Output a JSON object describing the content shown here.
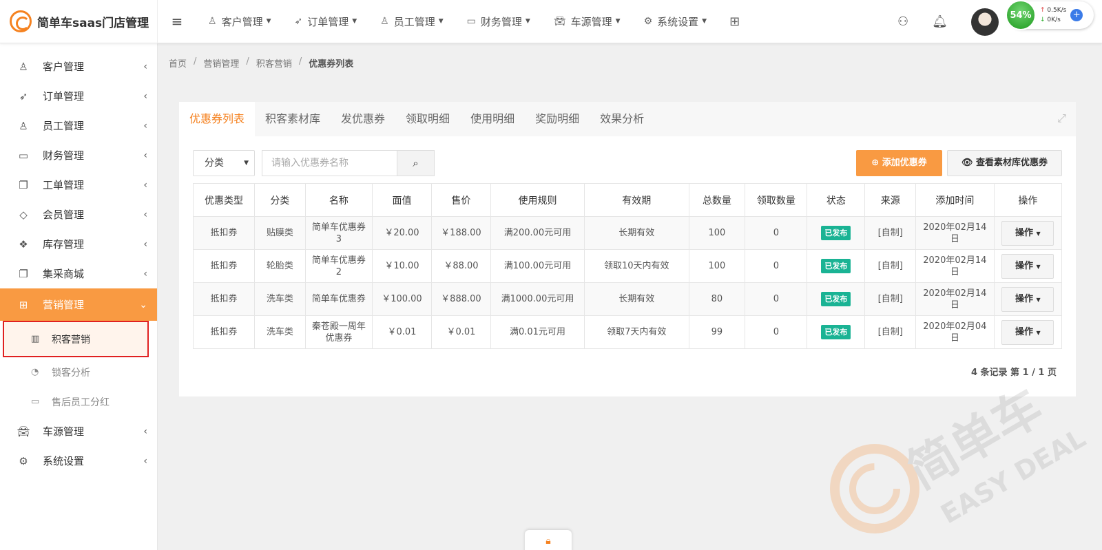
{
  "brand": {
    "title": "简单车saas门店管理"
  },
  "topnav": {
    "items": [
      {
        "label": "客户管理",
        "icon": "person-icon"
      },
      {
        "label": "订单管理",
        "icon": "rocket-icon"
      },
      {
        "label": "员工管理",
        "icon": "person-icon"
      },
      {
        "label": "财务管理",
        "icon": "folder-icon"
      },
      {
        "label": "车源管理",
        "icon": "car-icon"
      },
      {
        "label": "系统设置",
        "icon": "gear-icon"
      }
    ],
    "net": {
      "percent": "54%",
      "up": "0.5K/s",
      "down": "0K/s"
    }
  },
  "sidebar": {
    "items": [
      {
        "label": "客户管理"
      },
      {
        "label": "订单管理"
      },
      {
        "label": "员工管理"
      },
      {
        "label": "财务管理"
      },
      {
        "label": "工单管理"
      },
      {
        "label": "会员管理"
      },
      {
        "label": "库存管理"
      },
      {
        "label": "集采商城"
      },
      {
        "label": "营销管理"
      },
      {
        "label": "车源管理"
      },
      {
        "label": "系统设置"
      }
    ],
    "sub_items": [
      {
        "label": "积客营销"
      },
      {
        "label": "锁客分析"
      },
      {
        "label": "售后员工分红"
      }
    ]
  },
  "breadcrumb": [
    "首页",
    "营销管理",
    "积客营销",
    "优惠券列表"
  ],
  "tabs": [
    "优惠券列表",
    "积客素材库",
    "发优惠券",
    "领取明细",
    "使用明细",
    "奖励明细",
    "效果分析"
  ],
  "toolbar": {
    "category_label": "分类",
    "search_placeholder": "请输入优惠券名称",
    "add_label": "添加优惠券",
    "view_label": "查看素材库优惠券"
  },
  "table": {
    "headers": [
      "优惠类型",
      "分类",
      "名称",
      "面值",
      "售价",
      "使用规则",
      "有效期",
      "总数量",
      "领取数量",
      "状态",
      "来源",
      "添加时间",
      "操作"
    ],
    "rows": [
      [
        "抵扣券",
        "贴膜类",
        "简单车优惠券3",
        "￥20.00",
        "￥188.00",
        "满200.00元可用",
        "长期有效",
        "100",
        "0",
        "已发布",
        "[自制]",
        "2020年02月14日",
        "操作"
      ],
      [
        "抵扣券",
        "轮胎类",
        "简单车优惠券2",
        "￥10.00",
        "￥88.00",
        "满100.00元可用",
        "领取10天内有效",
        "100",
        "0",
        "已发布",
        "[自制]",
        "2020年02月14日",
        "操作"
      ],
      [
        "抵扣券",
        "洗车类",
        "简单车优惠券",
        "￥100.00",
        "￥888.00",
        "满1000.00元可用",
        "长期有效",
        "80",
        "0",
        "已发布",
        "[自制]",
        "2020年02月14日",
        "操作"
      ],
      [
        "抵扣券",
        "洗车类",
        "秦苍殿一周年优惠券",
        "￥0.01",
        "￥0.01",
        "满0.01元可用",
        "领取7天内有效",
        "99",
        "0",
        "已发布",
        "[自制]",
        "2020年02月04日",
        "操作"
      ]
    ]
  },
  "pager": {
    "text": "4 条记录 第 1 / 1 页"
  },
  "watermark": {
    "cn": "简单车",
    "en": "EASY DEAL"
  },
  "colors": {
    "accent": "#f99a42",
    "brand": "#f58220",
    "badge": "#1ab394",
    "highlight": "#e02020"
  }
}
